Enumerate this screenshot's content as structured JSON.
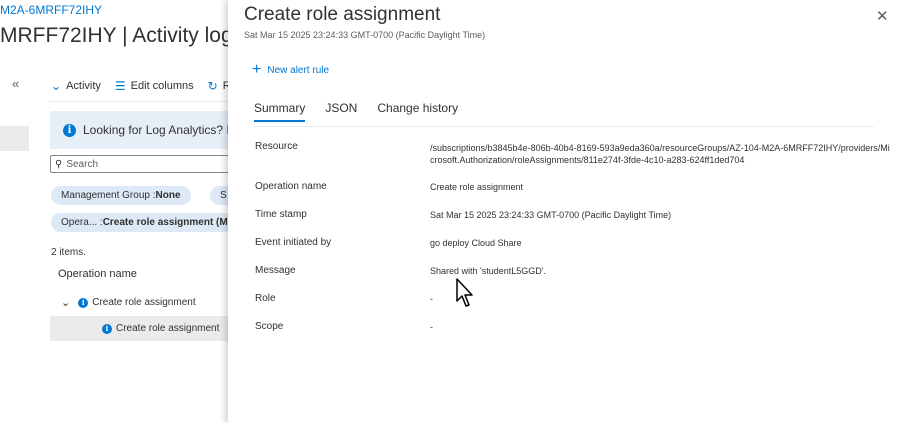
{
  "background": {
    "breadcrumb": "M2A-6MRFF72IHY",
    "page_title": "MRFF72IHY | Activity log",
    "toolbar": {
      "activity_label": "Activity",
      "edit_columns_label": "Edit columns",
      "refresh_label": "R"
    },
    "info_text": "Looking for Log Analytics? In",
    "search_placeholder": "Search",
    "filters": [
      {
        "key": "Management Group : ",
        "value": "None"
      },
      {
        "key": "S",
        "value": ""
      },
      {
        "key": "Opera... : ",
        "value": "Create role assignment (M"
      }
    ],
    "items_count": "2 items.",
    "column_header": "Operation name",
    "rows": [
      {
        "label": "Create role assignment"
      },
      {
        "label": "Create role assignment"
      }
    ]
  },
  "panel": {
    "title": "Create role assignment",
    "subtitle": "Sat Mar 15 2025 23:24:33 GMT-0700 (Pacific Daylight Time)",
    "new_alert_rule": "New alert rule",
    "tabs": [
      "Summary",
      "JSON",
      "Change history"
    ],
    "active_tab": "Summary",
    "properties": [
      {
        "label": "Resource",
        "value": "/subscriptions/b3845b4e-806b-40b4-8169-593a9eda360a/resourceGroups/AZ-104-M2A-6MRFF72IHY/providers/Microsoft.Authorization/roleAssignments/811e274f-3fde-4c10-a283-624ff1ded704"
      },
      {
        "label": "Operation name",
        "value": "Create role assignment"
      },
      {
        "label": "Time stamp",
        "value": "Sat Mar 15 2025 23:24:33 GMT-0700 (Pacific Daylight Time)"
      },
      {
        "label": "Event initiated by",
        "value": "go deploy Cloud Share"
      },
      {
        "label": "Message",
        "value": "Shared with 'studentL5GGD'."
      },
      {
        "label": "Role",
        "value": "-"
      },
      {
        "label": "Scope",
        "value": "-"
      }
    ]
  },
  "colors": {
    "accent": "#0078d4",
    "selected_row": "#edebe9",
    "info_bg": "#e6eef8",
    "pill_bg": "#dde9f7"
  }
}
